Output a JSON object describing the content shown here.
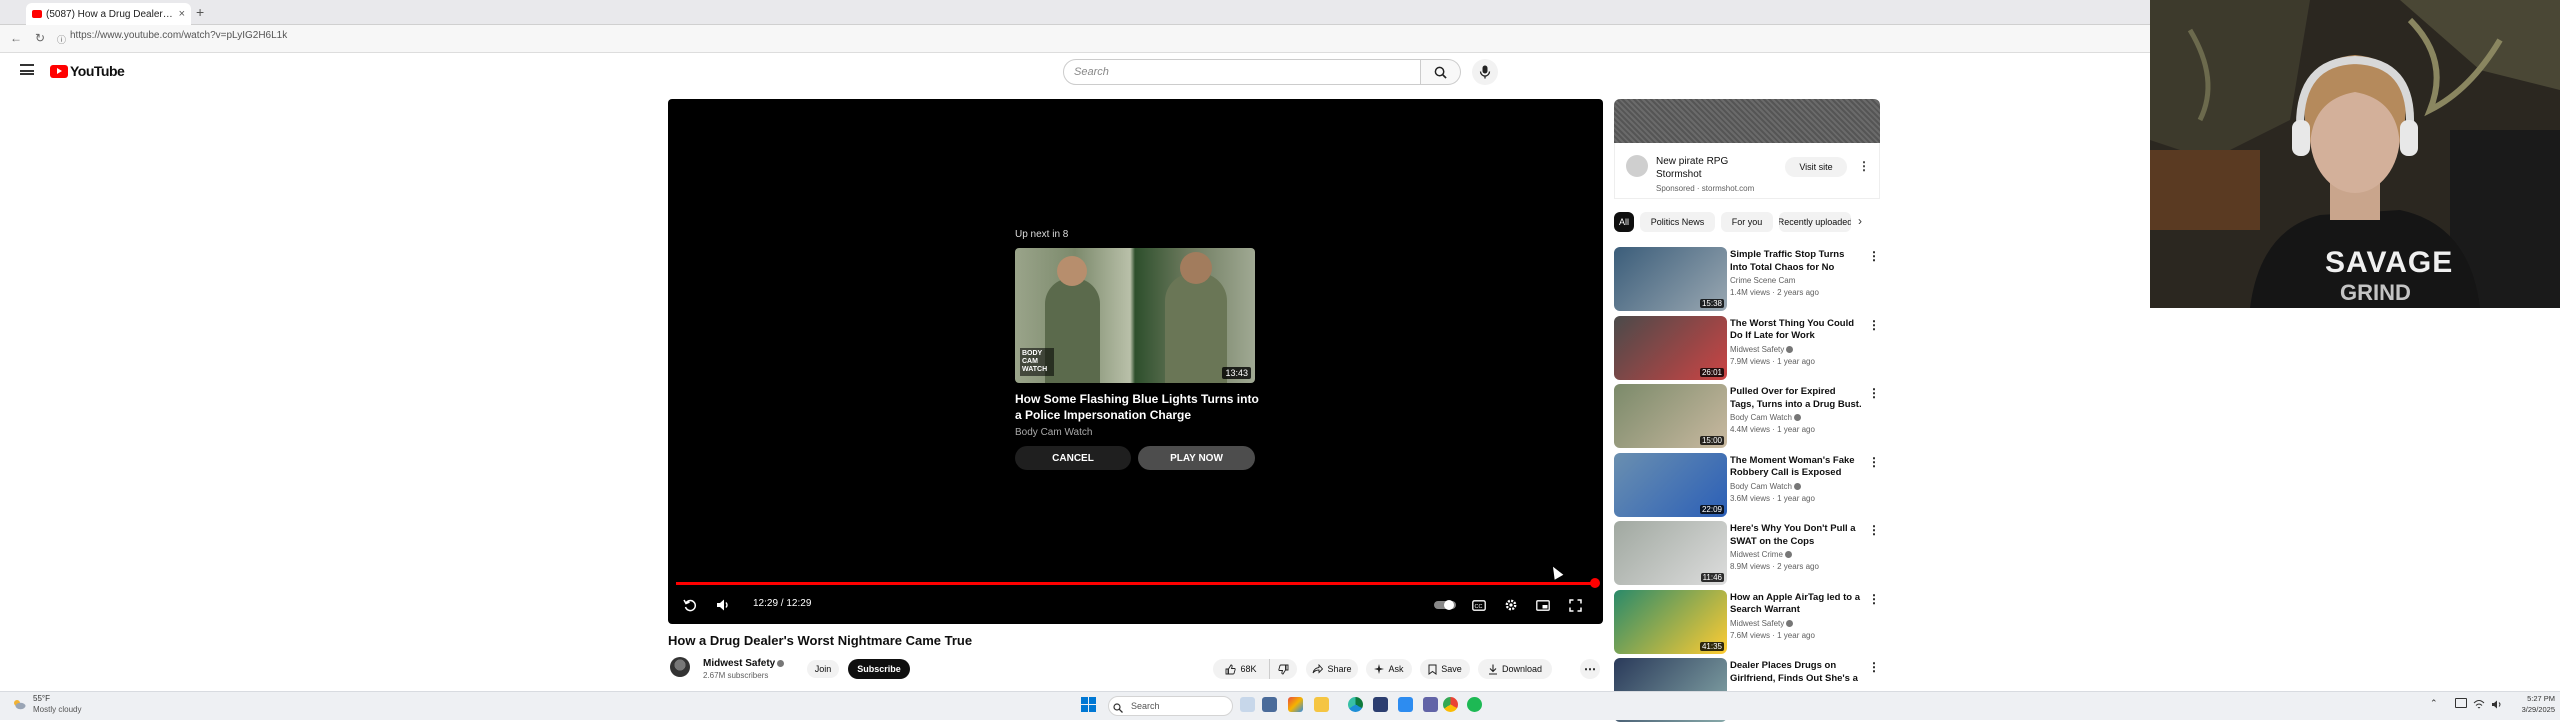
{
  "browser": {
    "tab_title": "(5087) How a Drug Dealer's W",
    "url": "https://www.youtube.com/watch?v=pLyIG2H6L1k"
  },
  "header": {
    "logo_text": "YouTube",
    "search_placeholder": "Search"
  },
  "player": {
    "upnext_label": "Up next in 8",
    "upnext_title": "How Some Flashing Blue Lights Turns into a Police Impersonation Charge",
    "upnext_channel": "Body Cam Watch",
    "upnext_duration": "13:43",
    "upnext_badge": "BODY CAM WATCH",
    "cancel_label": "CANCEL",
    "playnow_label": "PLAY NOW",
    "time_display": "12:29 / 12:29",
    "progress_fraction": 1.0
  },
  "video": {
    "title": "How a Drug Dealer's Worst Nightmare Came True",
    "channel": "Midwest Safety",
    "subscribers": "2.67M subscribers",
    "join_label": "Join",
    "subscribe_label": "Subscribe",
    "likes": "68K",
    "share_label": "Share",
    "ask_label": "Ask",
    "save_label": "Save",
    "download_label": "Download"
  },
  "ad": {
    "title": "New pirate RPG Stormshot",
    "sponsored": "Sponsored · stormshot.com",
    "visit_label": "Visit site"
  },
  "chips": [
    "All",
    "Politics News",
    "For you",
    "Recently uploaded"
  ],
  "recommendations": [
    {
      "title": "Simple Traffic Stop Turns Into Total Chaos for No Reason",
      "channel": "Crime Scene Cam",
      "meta": "1.4M views · 2 years ago",
      "duration": "15:38",
      "colors": [
        "#3b5d7a",
        "#9aa8b2"
      ],
      "verified": false
    },
    {
      "title": "The Worst Thing You Could Do If Late for Work",
      "channel": "Midwest Safety",
      "meta": "7.9M views · 1 year ago",
      "duration": "26:01",
      "colors": [
        "#4a4a4a",
        "#c44"
      ],
      "verified": true
    },
    {
      "title": "Pulled Over for Expired Tags, Turns into a Drug Bust.",
      "channel": "Body Cam Watch",
      "meta": "4.4M views · 1 year ago",
      "duration": "15:00",
      "colors": [
        "#7b8a6a",
        "#c9b9a0"
      ],
      "verified": true
    },
    {
      "title": "The Moment Woman's Fake Robbery Call is Exposed",
      "channel": "Body Cam Watch",
      "meta": "3.6M views · 1 year ago",
      "duration": "22:09",
      "colors": [
        "#6a8fb0",
        "#2b5fb7"
      ],
      "verified": true
    },
    {
      "title": "Here's Why You Don't Pull a SWAT on the Cops",
      "channel": "Midwest Crime",
      "meta": "8.9M views · 2 years ago",
      "duration": "11:46",
      "colors": [
        "#a0a8a0",
        "#ddd"
      ],
      "verified": true
    },
    {
      "title": "How an Apple AirTag led to a Search Warrant",
      "channel": "Midwest Safety",
      "meta": "7.6M views · 1 year ago",
      "duration": "41:35",
      "colors": [
        "#2a8a6a",
        "#ffcc33"
      ],
      "verified": true
    },
    {
      "title": "Dealer Places Drugs on Girlfriend, Finds Out She's a ...",
      "channel": "",
      "meta": "",
      "duration": "",
      "colors": [
        "#2a3a5a",
        "#8aa"
      ],
      "verified": false
    }
  ],
  "taskbar": {
    "weather_temp": "55°F",
    "weather_desc": "Mostly cloudy",
    "search_label": "Search",
    "clock_time": "5:27 PM",
    "clock_date": "3/29/2025"
  },
  "colors": {
    "accent": "#ff0000",
    "subscribe_bg": "#0f0f0f",
    "chip_bg": "#f2f2f2"
  }
}
